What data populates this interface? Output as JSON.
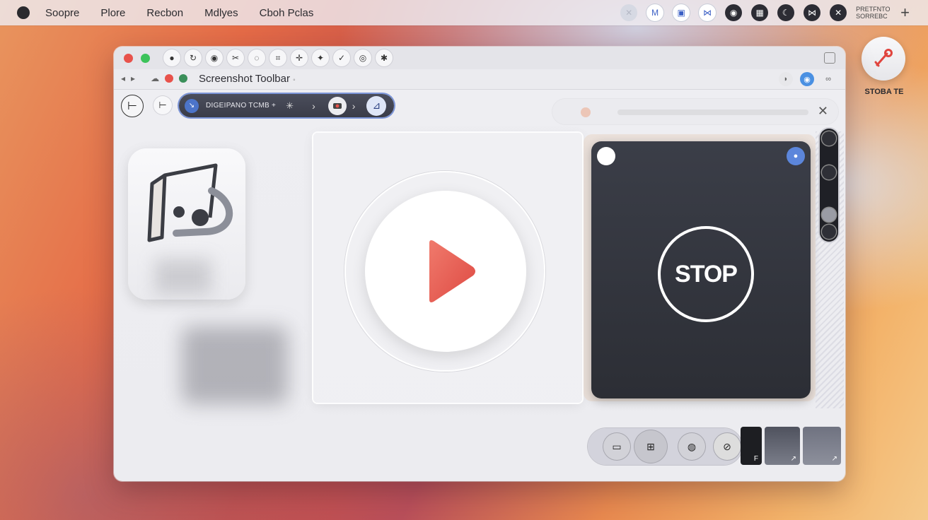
{
  "menubar": {
    "items": [
      "Soopre",
      "Plore",
      "Recbon",
      "Mdlyes",
      "Cboh Pclas"
    ],
    "status_text_line1": "PRETFNTO",
    "status_text_line2": "SORREBC",
    "plus_label": "+"
  },
  "record_widget": {
    "label": "STOBA TE"
  },
  "window": {
    "address_title": "Screenshot Toolbar",
    "address_suffix": "◦",
    "toolbar": {
      "back_label": "⊢",
      "small_label": "⊢",
      "pill_text": "DIGEIPANO TCMB +",
      "pill_star": "✳",
      "pill_chevron": "›",
      "pill_end": "⊿"
    },
    "stop_label": "STOP",
    "thumb_labels": [
      "F",
      "↗",
      "↗"
    ]
  },
  "colors": {
    "play_triangle": "#e85a50",
    "stop_panel": "#2f3139",
    "accent_blue": "#5c86db",
    "traffic_red": "#e8524b",
    "traffic_green": "#3cc35a"
  }
}
